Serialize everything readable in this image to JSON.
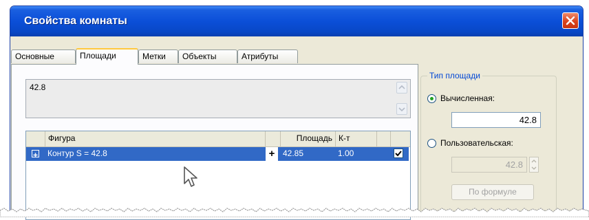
{
  "window": {
    "title": "Свойства комнаты"
  },
  "tabs": [
    {
      "label": "Основные",
      "active": false
    },
    {
      "label": "Площади",
      "active": true
    },
    {
      "label": "Метки",
      "active": false
    },
    {
      "label": "Объекты",
      "active": false
    },
    {
      "label": "Атрибуты",
      "active": false
    }
  ],
  "area_box": {
    "value": "42.8"
  },
  "table": {
    "columns": [
      "Фигура",
      "Площадь",
      "К-т"
    ],
    "rows": [
      {
        "figure": "Контур S = 42.8",
        "plus": "+",
        "area": "42.85",
        "coef": "1.00",
        "checked": true,
        "selected": true
      }
    ]
  },
  "area_type": {
    "legend": "Тип площади",
    "calculated": {
      "label": "Вычисленная:",
      "value": "42.8",
      "selected": true
    },
    "custom": {
      "label": "Пользовательская:",
      "value": "42.8",
      "selected": false,
      "disabled": true
    },
    "formula_button": "По формуле"
  },
  "colors": {
    "title_bar": "#0b4fd8",
    "selection": "#3169c6",
    "tab_accent": "#ffc83c",
    "legend_text": "#0046d5"
  },
  "icons": [
    "close-icon",
    "scroll-up-icon",
    "scroll-down-icon",
    "expand-plus-icon",
    "checkmark-icon",
    "spin-up-icon",
    "mouse-pointer-icon"
  ]
}
